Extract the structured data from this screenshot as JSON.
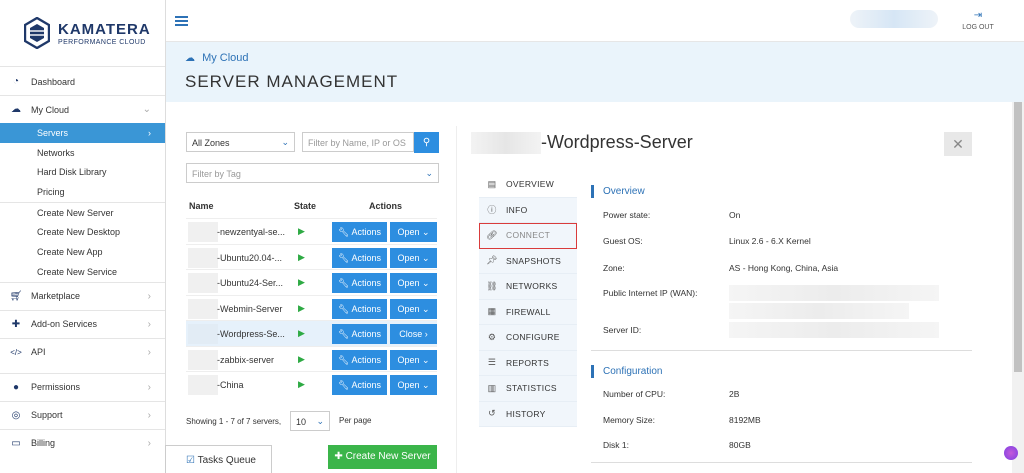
{
  "logo": {
    "title": "KAMATERA",
    "subtitle": "PERFORMANCE CLOUD"
  },
  "sidebar": {
    "items": [
      {
        "label": "Dashboard",
        "icon": "dashboard-icon"
      },
      {
        "label": "My Cloud",
        "icon": "cloud-icon"
      },
      {
        "label": "Marketplace",
        "icon": "cart-icon"
      },
      {
        "label": "Add-on Services",
        "icon": "puzzle-icon"
      },
      {
        "label": "API",
        "icon": "code-icon"
      },
      {
        "label": "Permissions",
        "icon": "users-icon"
      },
      {
        "label": "Support",
        "icon": "headset-icon"
      },
      {
        "label": "Billing",
        "icon": "credit-card-icon"
      }
    ],
    "mycloud_sub": [
      "Servers",
      "Networks",
      "Hard Disk Library",
      "Pricing"
    ],
    "mycloud_create": [
      "Create New Server",
      "Create New Desktop",
      "Create New App",
      "Create New Service"
    ]
  },
  "topbar": {
    "logout": "LOG OUT"
  },
  "header": {
    "breadcrumb": "My Cloud",
    "title": "SERVER MANAGEMENT"
  },
  "filters": {
    "zone": "All Zones",
    "search_placeholder": "Filter by Name, IP or OS",
    "tag_placeholder": "Filter by Tag"
  },
  "table": {
    "headers": {
      "name": "Name",
      "state": "State",
      "actions": "Actions"
    },
    "rows": [
      {
        "name": "-newzentyal-se...",
        "action": "Actions",
        "toggle": "Open"
      },
      {
        "name": "-Ubuntu20.04-...",
        "action": "Actions",
        "toggle": "Open"
      },
      {
        "name": "-Ubuntu24-Ser...",
        "action": "Actions",
        "toggle": "Open"
      },
      {
        "name": "-Webmin-Server",
        "action": "Actions",
        "toggle": "Open"
      },
      {
        "name": "-Wordpress-Se...",
        "action": "Actions",
        "toggle": "Close"
      },
      {
        "name": "-zabbix-server",
        "action": "Actions",
        "toggle": "Open"
      },
      {
        "name": "-China",
        "action": "Actions",
        "toggle": "Open"
      }
    ]
  },
  "pagination": {
    "showing": "Showing 1 - 7 of 7 servers,",
    "per_page_value": "10",
    "per_page_label": "Per page"
  },
  "footer": {
    "tasks": "Tasks Queue",
    "create": "Create New Server"
  },
  "server": {
    "name": "-Wordpress-Server",
    "tabs": [
      {
        "label": "OVERVIEW",
        "icon": "document-icon"
      },
      {
        "label": "INFO",
        "icon": "info-icon"
      },
      {
        "label": "CONNECT",
        "icon": "link-icon"
      },
      {
        "label": "SNAPSHOTS",
        "icon": "pin-icon"
      },
      {
        "label": "NETWORKS",
        "icon": "network-icon"
      },
      {
        "label": "FIREWALL",
        "icon": "firewall-icon"
      },
      {
        "label": "CONFIGURE",
        "icon": "cogs-icon"
      },
      {
        "label": "REPORTS",
        "icon": "list-icon"
      },
      {
        "label": "STATISTICS",
        "icon": "bar-chart-icon"
      },
      {
        "label": "HISTORY",
        "icon": "history-icon"
      }
    ],
    "overview": {
      "title": "Overview",
      "fields": [
        {
          "key": "Power state:",
          "value": "On"
        },
        {
          "key": "Guest OS:",
          "value": "Linux 2.6 - 6.X Kernel"
        },
        {
          "key": "Zone:",
          "value": "AS - Hong Kong, China, Asia"
        },
        {
          "key": "Public Internet IP (WAN):",
          "value": ""
        },
        {
          "key": "Server ID:",
          "value": ""
        }
      ]
    },
    "configuration": {
      "title": "Configuration",
      "fields": [
        {
          "key": "Number of CPU:",
          "value": "2B"
        },
        {
          "key": "Memory Size:",
          "value": "8192MB"
        },
        {
          "key": "Disk 1:",
          "value": "80GB"
        }
      ]
    }
  }
}
